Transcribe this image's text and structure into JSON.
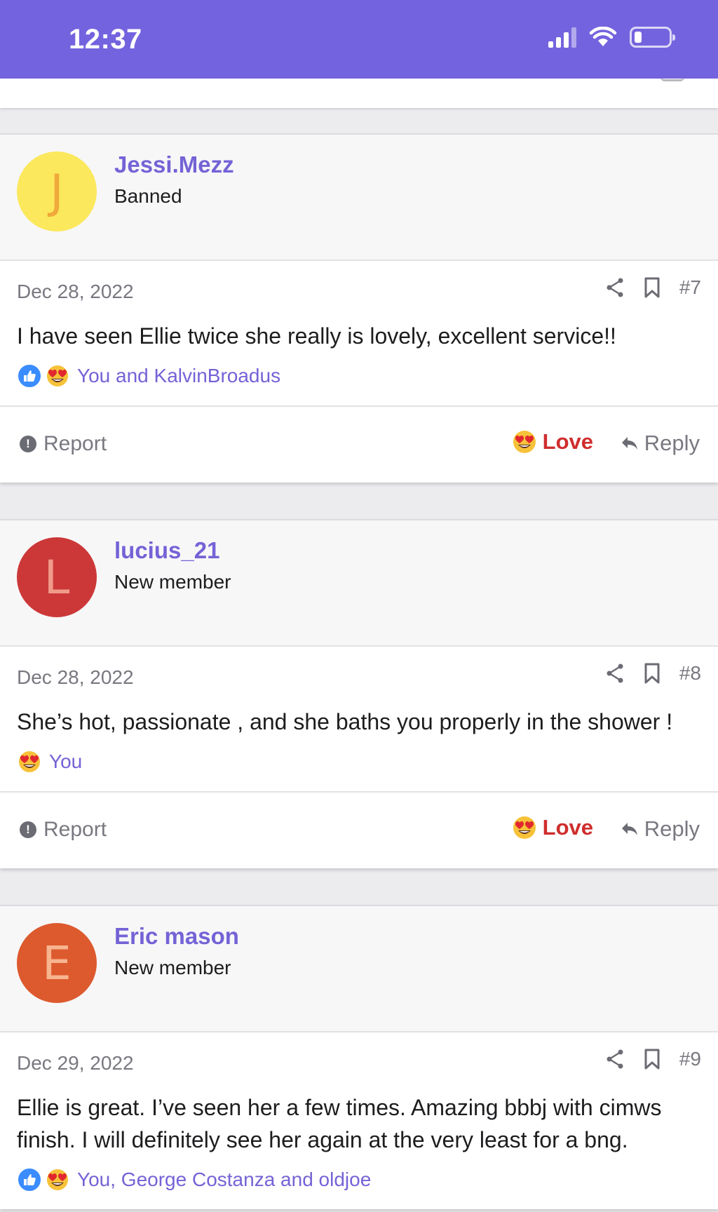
{
  "status_bar": {
    "time": "12:37",
    "icons": [
      "cellular-signal-icon",
      "wifi-icon",
      "battery-icon"
    ],
    "battery_level": 0.2
  },
  "colors": {
    "header_bg": "#7463de",
    "username": "#7463d6",
    "love": "#cf2d2d",
    "muted": "#787880"
  },
  "posts": [
    {
      "username": "Jessi.Mezz",
      "user_title": "Banned",
      "avatar_letter": "J",
      "avatar_color": "#fbe85d",
      "avatar_text_color": "#f0a93a",
      "date": "Dec 28, 2022",
      "number": "#7",
      "body": "I have seen Ellie twice she really is lovely, excellent service!!",
      "reactions_text": "You and KalvinBroadus",
      "reaction_icons": [
        "like-icon",
        "love-eyes-icon"
      ],
      "report_label": "Report",
      "love_label": "Love",
      "reply_label": "Reply"
    },
    {
      "username": "lucius_21",
      "user_title": "New member",
      "avatar_letter": "L",
      "avatar_color": "#cc3838",
      "avatar_text_color": "#f09a8a",
      "date": "Dec 28, 2022",
      "number": "#8",
      "body": "She’s hot, passionate , and she baths you properly in the shower !",
      "reactions_text": "You",
      "reaction_icons": [
        "love-eyes-icon"
      ],
      "report_label": "Report",
      "love_label": "Love",
      "reply_label": "Reply"
    },
    {
      "username": "Eric mason",
      "user_title": "New member",
      "avatar_letter": "E",
      "avatar_color": "#dd5a2e",
      "avatar_text_color": "#f7b48f",
      "date": "Dec 29, 2022",
      "number": "#9",
      "body": "Ellie is great. I’ve seen her a few times. Amazing bbbj with cimws finish. I will definitely see her again at the very least for a bng.",
      "reactions_text": "You, George Costanza and oldjoe",
      "reaction_icons": [
        "like-icon",
        "love-eyes-icon"
      ]
    }
  ]
}
